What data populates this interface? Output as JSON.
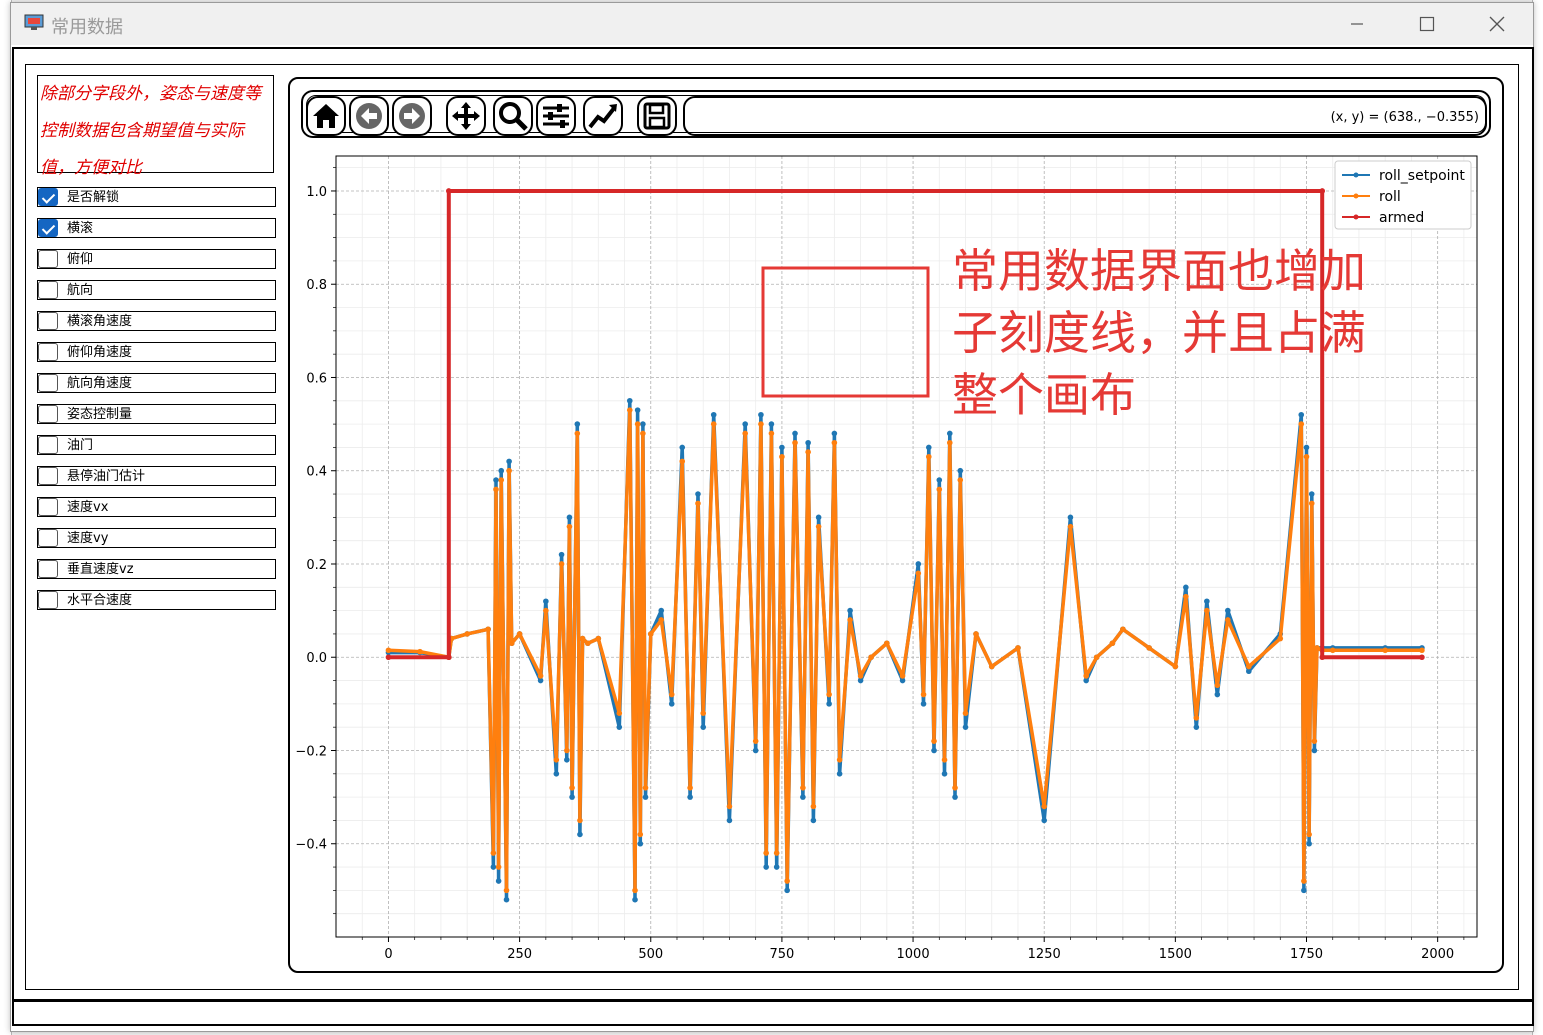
{
  "window": {
    "title": "常用数据"
  },
  "sidebar": {
    "note": "除部分字段外，姿态与速度等控制数据包含期望值与实际值，方便对比",
    "checkboxes": [
      {
        "label": "是否解锁",
        "checked": true
      },
      {
        "label": "横滚",
        "checked": true
      },
      {
        "label": "俯仰",
        "checked": false
      },
      {
        "label": "航向",
        "checked": false
      },
      {
        "label": "横滚角速度",
        "checked": false
      },
      {
        "label": "俯仰角速度",
        "checked": false
      },
      {
        "label": "航向角速度",
        "checked": false
      },
      {
        "label": "姿态控制量",
        "checked": false
      },
      {
        "label": "油门",
        "checked": false
      },
      {
        "label": "悬停油门估计",
        "checked": false
      },
      {
        "label": "速度vx",
        "checked": false
      },
      {
        "label": "速度vy",
        "checked": false
      },
      {
        "label": "垂直速度vz",
        "checked": false
      },
      {
        "label": "水平合速度",
        "checked": false
      }
    ]
  },
  "toolbar": {
    "icons": [
      "home-icon",
      "back-arrow-icon",
      "forward-arrow-icon",
      "pan-icon",
      "zoom-icon",
      "subplots-icon",
      "axes-edit-icon",
      "save-icon"
    ],
    "coordinates": "(x, y) = (638., −0.355)"
  },
  "annotation": {
    "lines": [
      "常用数据界面也增加",
      "子刻度线，并且占满",
      "整个画布"
    ],
    "color": "#e53935"
  },
  "chart_data": {
    "type": "line",
    "title": "",
    "xlabel": "",
    "ylabel": "",
    "xlim": [
      -100,
      2075
    ],
    "ylim": [
      -0.6,
      1.075
    ],
    "xticks": [
      0,
      250,
      500,
      750,
      1000,
      1250,
      1500,
      1750,
      2000
    ],
    "yticks": [
      -0.4,
      -0.2,
      0.0,
      0.2,
      0.4,
      0.6,
      0.8,
      1.0
    ],
    "xtick_labels": [
      "0",
      "250",
      "500",
      "750",
      "1000",
      "1250",
      "1500",
      "1750",
      "2000"
    ],
    "ytick_labels": [
      "−0.4",
      "−0.2",
      "0.0",
      "0.2",
      "0.4",
      "0.6",
      "0.8",
      "1.0"
    ],
    "grid": true,
    "minor_grid": true,
    "legend": "top-right",
    "series": [
      {
        "name": "roll_setpoint",
        "color": "#1f77b4",
        "x": [
          0,
          60,
          115,
          120,
          150,
          190,
          200,
          205,
          210,
          215,
          225,
          230,
          235,
          250,
          290,
          300,
          320,
          330,
          340,
          345,
          350,
          360,
          365,
          370,
          380,
          400,
          440,
          460,
          470,
          475,
          480,
          485,
          490,
          500,
          520,
          540,
          560,
          575,
          590,
          600,
          620,
          650,
          680,
          700,
          710,
          720,
          730,
          740,
          750,
          760,
          775,
          790,
          800,
          810,
          820,
          840,
          850,
          860,
          880,
          900,
          920,
          950,
          980,
          1010,
          1020,
          1030,
          1040,
          1050,
          1060,
          1070,
          1080,
          1090,
          1100,
          1120,
          1150,
          1200,
          1250,
          1300,
          1330,
          1350,
          1380,
          1400,
          1450,
          1500,
          1520,
          1540,
          1560,
          1580,
          1600,
          1640,
          1700,
          1740,
          1745,
          1750,
          1755,
          1760,
          1765,
          1770,
          1780,
          1800,
          1900,
          1970
        ],
        "y": [
          0.01,
          0.01,
          0.0,
          0.04,
          0.05,
          0.06,
          -0.45,
          0.38,
          -0.48,
          0.4,
          -0.52,
          0.42,
          0.03,
          0.05,
          -0.05,
          0.12,
          -0.25,
          0.22,
          -0.22,
          0.3,
          -0.3,
          0.5,
          -0.38,
          0.04,
          0.03,
          0.04,
          -0.15,
          0.55,
          -0.52,
          0.53,
          -0.4,
          0.5,
          -0.3,
          0.05,
          0.1,
          -0.1,
          0.45,
          -0.3,
          0.35,
          -0.15,
          0.52,
          -0.35,
          0.5,
          -0.2,
          0.52,
          -0.45,
          0.5,
          -0.45,
          0.45,
          -0.5,
          0.48,
          -0.3,
          0.46,
          -0.35,
          0.3,
          -0.1,
          0.48,
          -0.25,
          0.1,
          -0.05,
          0.0,
          0.03,
          -0.05,
          0.2,
          -0.1,
          0.45,
          -0.2,
          0.38,
          -0.25,
          0.48,
          -0.3,
          0.4,
          -0.15,
          0.05,
          -0.02,
          0.02,
          -0.35,
          0.3,
          -0.05,
          0.0,
          0.03,
          0.06,
          0.02,
          -0.02,
          0.15,
          -0.15,
          0.12,
          -0.08,
          0.1,
          -0.03,
          0.05,
          0.52,
          -0.5,
          0.45,
          -0.4,
          0.35,
          -0.2,
          0.02,
          0.02,
          0.02,
          0.02,
          0.02
        ]
      },
      {
        "name": "roll",
        "color": "#ff7f0e",
        "x": [
          0,
          60,
          115,
          120,
          150,
          190,
          200,
          205,
          210,
          215,
          225,
          230,
          235,
          250,
          290,
          300,
          320,
          330,
          340,
          345,
          350,
          360,
          365,
          370,
          380,
          400,
          440,
          460,
          470,
          475,
          480,
          485,
          490,
          500,
          520,
          540,
          560,
          575,
          590,
          600,
          620,
          650,
          680,
          700,
          710,
          720,
          730,
          740,
          750,
          760,
          775,
          790,
          800,
          810,
          820,
          840,
          850,
          860,
          880,
          900,
          920,
          950,
          980,
          1010,
          1020,
          1030,
          1040,
          1050,
          1060,
          1070,
          1080,
          1090,
          1100,
          1120,
          1150,
          1200,
          1250,
          1300,
          1330,
          1350,
          1380,
          1400,
          1450,
          1500,
          1520,
          1540,
          1560,
          1580,
          1600,
          1640,
          1700,
          1740,
          1745,
          1750,
          1755,
          1760,
          1765,
          1770,
          1780,
          1800,
          1900,
          1970
        ],
        "y": [
          0.015,
          0.012,
          0.0,
          0.04,
          0.05,
          0.06,
          -0.42,
          0.36,
          -0.45,
          0.38,
          -0.5,
          0.4,
          0.03,
          0.05,
          -0.04,
          0.1,
          -0.22,
          0.2,
          -0.2,
          0.28,
          -0.28,
          0.48,
          -0.35,
          0.04,
          0.03,
          0.04,
          -0.12,
          0.53,
          -0.5,
          0.5,
          -0.38,
          0.48,
          -0.28,
          0.05,
          0.08,
          -0.08,
          0.42,
          -0.28,
          0.33,
          -0.12,
          0.5,
          -0.32,
          0.48,
          -0.18,
          0.5,
          -0.42,
          0.48,
          -0.42,
          0.43,
          -0.48,
          0.46,
          -0.28,
          0.44,
          -0.32,
          0.28,
          -0.08,
          0.46,
          -0.22,
          0.08,
          -0.04,
          0.0,
          0.03,
          -0.04,
          0.18,
          -0.08,
          0.43,
          -0.18,
          0.36,
          -0.22,
          0.46,
          -0.28,
          0.38,
          -0.12,
          0.05,
          -0.02,
          0.02,
          -0.32,
          0.28,
          -0.04,
          0.0,
          0.03,
          0.06,
          0.02,
          -0.02,
          0.13,
          -0.13,
          0.1,
          -0.06,
          0.08,
          -0.02,
          0.04,
          0.5,
          -0.48,
          0.43,
          -0.38,
          0.33,
          -0.18,
          0.02,
          0.015,
          0.015,
          0.015,
          0.015
        ]
      },
      {
        "name": "armed",
        "color": "#d62728",
        "x": [
          0,
          115,
          115,
          1780,
          1780,
          1970
        ],
        "y": [
          0,
          0,
          1,
          1,
          0,
          0
        ]
      }
    ]
  }
}
